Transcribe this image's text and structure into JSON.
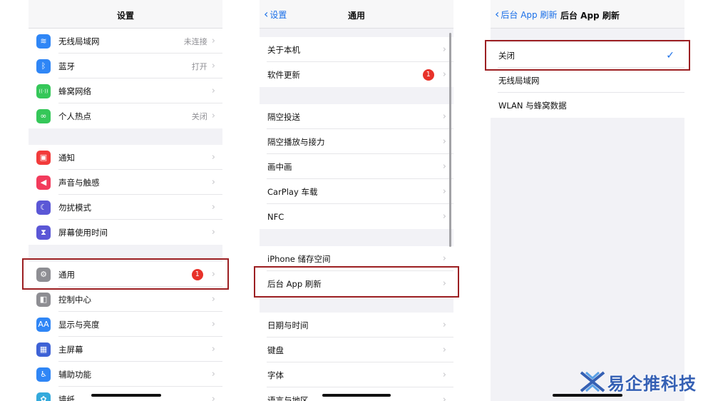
{
  "settings": {
    "title": "设置",
    "group1": [
      {
        "icon": "wifi-icon",
        "color": "#2f86f6",
        "glyph": "≋",
        "label": "无线局域网",
        "value": "未连接"
      },
      {
        "icon": "bluetooth-icon",
        "color": "#2f86f6",
        "glyph": "ᛒ",
        "label": "蓝牙",
        "value": "打开"
      },
      {
        "icon": "cellular-icon",
        "color": "#35c759",
        "glyph": "((·))",
        "label": "蜂窝网络",
        "value": ""
      },
      {
        "icon": "hotspot-icon",
        "color": "#35c759",
        "glyph": "∞",
        "label": "个人热点",
        "value": "关闭"
      }
    ],
    "group2": [
      {
        "icon": "notifications-icon",
        "color": "#f23b3b",
        "glyph": "▣",
        "label": "通知"
      },
      {
        "icon": "sounds-icon",
        "color": "#f23b5c",
        "glyph": "◀",
        "label": "声音与触感"
      },
      {
        "icon": "do-not-disturb-icon",
        "color": "#5b57d6",
        "glyph": "☾",
        "label": "勿扰模式"
      },
      {
        "icon": "screen-time-icon",
        "color": "#5b57d6",
        "glyph": "⧗",
        "label": "屏幕使用时间"
      }
    ],
    "group3": [
      {
        "icon": "gear-icon",
        "color": "#8e8e93",
        "glyph": "⚙",
        "label": "通用",
        "badge": "1"
      },
      {
        "icon": "control-center-icon",
        "color": "#8e8e93",
        "glyph": "◧",
        "label": "控制中心"
      },
      {
        "icon": "display-icon",
        "color": "#2f86f6",
        "glyph": "AA",
        "label": "显示与亮度"
      },
      {
        "icon": "home-screen-icon",
        "color": "#3e62d6",
        "glyph": "▦",
        "label": "主屏幕"
      },
      {
        "icon": "accessibility-icon",
        "color": "#2f86f6",
        "glyph": "♿",
        "label": "辅助功能"
      },
      {
        "icon": "wallpaper-icon",
        "color": "#34aadc",
        "glyph": "✿",
        "label": "墙纸"
      }
    ]
  },
  "general": {
    "back_label": "设置",
    "title": "通用",
    "group1": [
      {
        "label": "关于本机"
      },
      {
        "label": "软件更新",
        "badge": "1"
      }
    ],
    "group2": [
      {
        "label": "隔空投送"
      },
      {
        "label": "隔空播放与接力"
      },
      {
        "label": "画中画"
      },
      {
        "label": "CarPlay 车载"
      },
      {
        "label": "NFC"
      }
    ],
    "group3": [
      {
        "label": "iPhone 储存空间"
      },
      {
        "label": "后台 App 刷新"
      }
    ],
    "group4": [
      {
        "label": "日期与时间"
      },
      {
        "label": "键盘"
      },
      {
        "label": "字体"
      },
      {
        "label": "语言与地区"
      }
    ]
  },
  "refresh": {
    "back_label": "后台 App 刷新",
    "title": "后台 App 刷新",
    "options": [
      {
        "label": "关闭",
        "selected": true
      },
      {
        "label": "无线局域网",
        "selected": false
      },
      {
        "label": "WLAN 与蜂窝数据",
        "selected": false
      }
    ]
  },
  "glyphs": {
    "chevron": "›",
    "check": "✓",
    "back": "‹"
  },
  "highlight_color": "#9c1f22",
  "watermark": {
    "text": "易企推科技",
    "color": "#3560b4"
  }
}
